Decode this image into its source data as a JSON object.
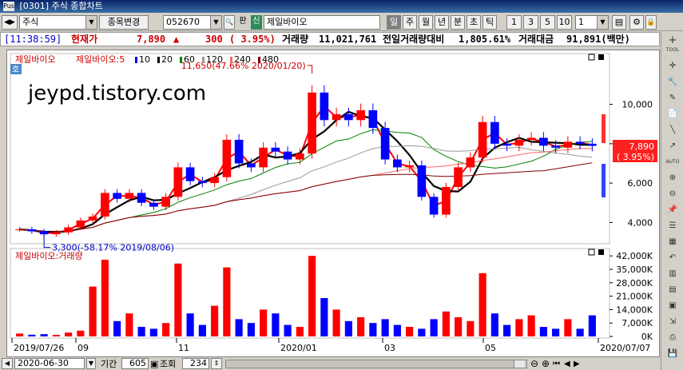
{
  "window": {
    "title": "[0301] 주식 종합차트",
    "icon_text": "Pus"
  },
  "toolbar": {
    "market": "주식",
    "change_code_label": "종목변경",
    "code": "052670",
    "pan_label": "판",
    "sin_label": "신",
    "stock_name": "제일바이오",
    "period_buttons": [
      "일",
      "주",
      "월",
      "년",
      "분",
      "초",
      "틱"
    ],
    "selected_period": "일",
    "interval_buttons": [
      "1",
      "3",
      "5",
      "10"
    ],
    "interval_value": "1"
  },
  "quote": {
    "time": "[11:38:59]",
    "price_label": "현재가",
    "price": "7,890",
    "change_arrow": "▲",
    "change": "300",
    "change_pct": "( 3.95%)",
    "volume_label": "거래량",
    "volume": "11,021,761",
    "prev_vol_label": "전일거래량대비",
    "prev_vol_pct": "1,805.61%",
    "amount_label": "거래대금",
    "amount": "91,891(백만)"
  },
  "price_legend": {
    "name": "제일바이오",
    "ma_label": "제일바이오:5",
    "ma_items": [
      {
        "label": "10",
        "color": "#0000ff"
      },
      {
        "label": "20",
        "color": "#000000"
      },
      {
        "label": "60",
        "color": "#008000"
      },
      {
        "label": "120",
        "color": "#999999"
      },
      {
        "label": "240",
        "color": "#ff6666"
      },
      {
        "label": "480",
        "color": "#800000"
      }
    ]
  },
  "watermark": "jeypd.tistory.com",
  "ho_badge": "호",
  "chart_data": [
    {
      "type": "candlestick",
      "title": "제일바이오",
      "x": [
        "2019/07/26",
        "09",
        "11",
        "2020/01",
        "03",
        "05",
        "2020/07/07"
      ],
      "yticks": [
        "10,000",
        "8,000",
        "6,000",
        "4,000"
      ],
      "ylim": [
        3000,
        12500
      ],
      "series": [
        {
          "name": "close",
          "values": [
            3650,
            3550,
            3400,
            3500,
            3750,
            4100,
            4300,
            5500,
            5200,
            5500,
            5000,
            4800,
            5300,
            6800,
            6100,
            6000,
            6300,
            8200,
            7000,
            6800,
            7800,
            7600,
            7200,
            7500,
            10600,
            9200,
            9500,
            9200,
            9700,
            8800,
            7200,
            6800,
            6900,
            5300,
            4400,
            5800,
            6800,
            7300,
            9100,
            8000,
            7900,
            8200,
            8300,
            7900,
            7800,
            8100,
            8000,
            7890
          ]
        }
      ],
      "annotations": [
        "11,650(47.66% 2020/01/20)",
        "3,300(-58.17% 2019/08/06)"
      ],
      "last_price_label": "7,890",
      "last_pct_label": "( 3.95%)"
    },
    {
      "type": "bar",
      "title": "제일바이오:거래량",
      "yticks": [
        "42,000K",
        "35,000K",
        "28,000K",
        "21,000K",
        "14,000K",
        "7,000K",
        "0K"
      ],
      "ylim": [
        0,
        45000
      ],
      "series": [
        {
          "name": "거래량",
          "values": [
            1500,
            900,
            1200,
            800,
            2000,
            3000,
            26000,
            40000,
            8000,
            12000,
            5000,
            4000,
            7000,
            38000,
            12000,
            6000,
            16000,
            36000,
            9000,
            7000,
            14000,
            12000,
            6000,
            5000,
            42000,
            20000,
            14000,
            8000,
            10000,
            7000,
            9000,
            6000,
            5000,
            4000,
            9000,
            13000,
            10000,
            8000,
            33000,
            12000,
            6000,
            9000,
            11000,
            5000,
            4000,
            9000,
            4000,
            11000
          ]
        }
      ]
    }
  ],
  "date_axis": [
    "2019/07/26",
    "09",
    "11",
    "2020/01",
    "03",
    "05",
    "2020/07/07"
  ],
  "bottom": {
    "date": "2020-06-30",
    "period_label": "기간",
    "period_value": "605",
    "query_label": "조회",
    "query_value": "234"
  },
  "right_tools": [
    "TOOL",
    "AUTO"
  ]
}
